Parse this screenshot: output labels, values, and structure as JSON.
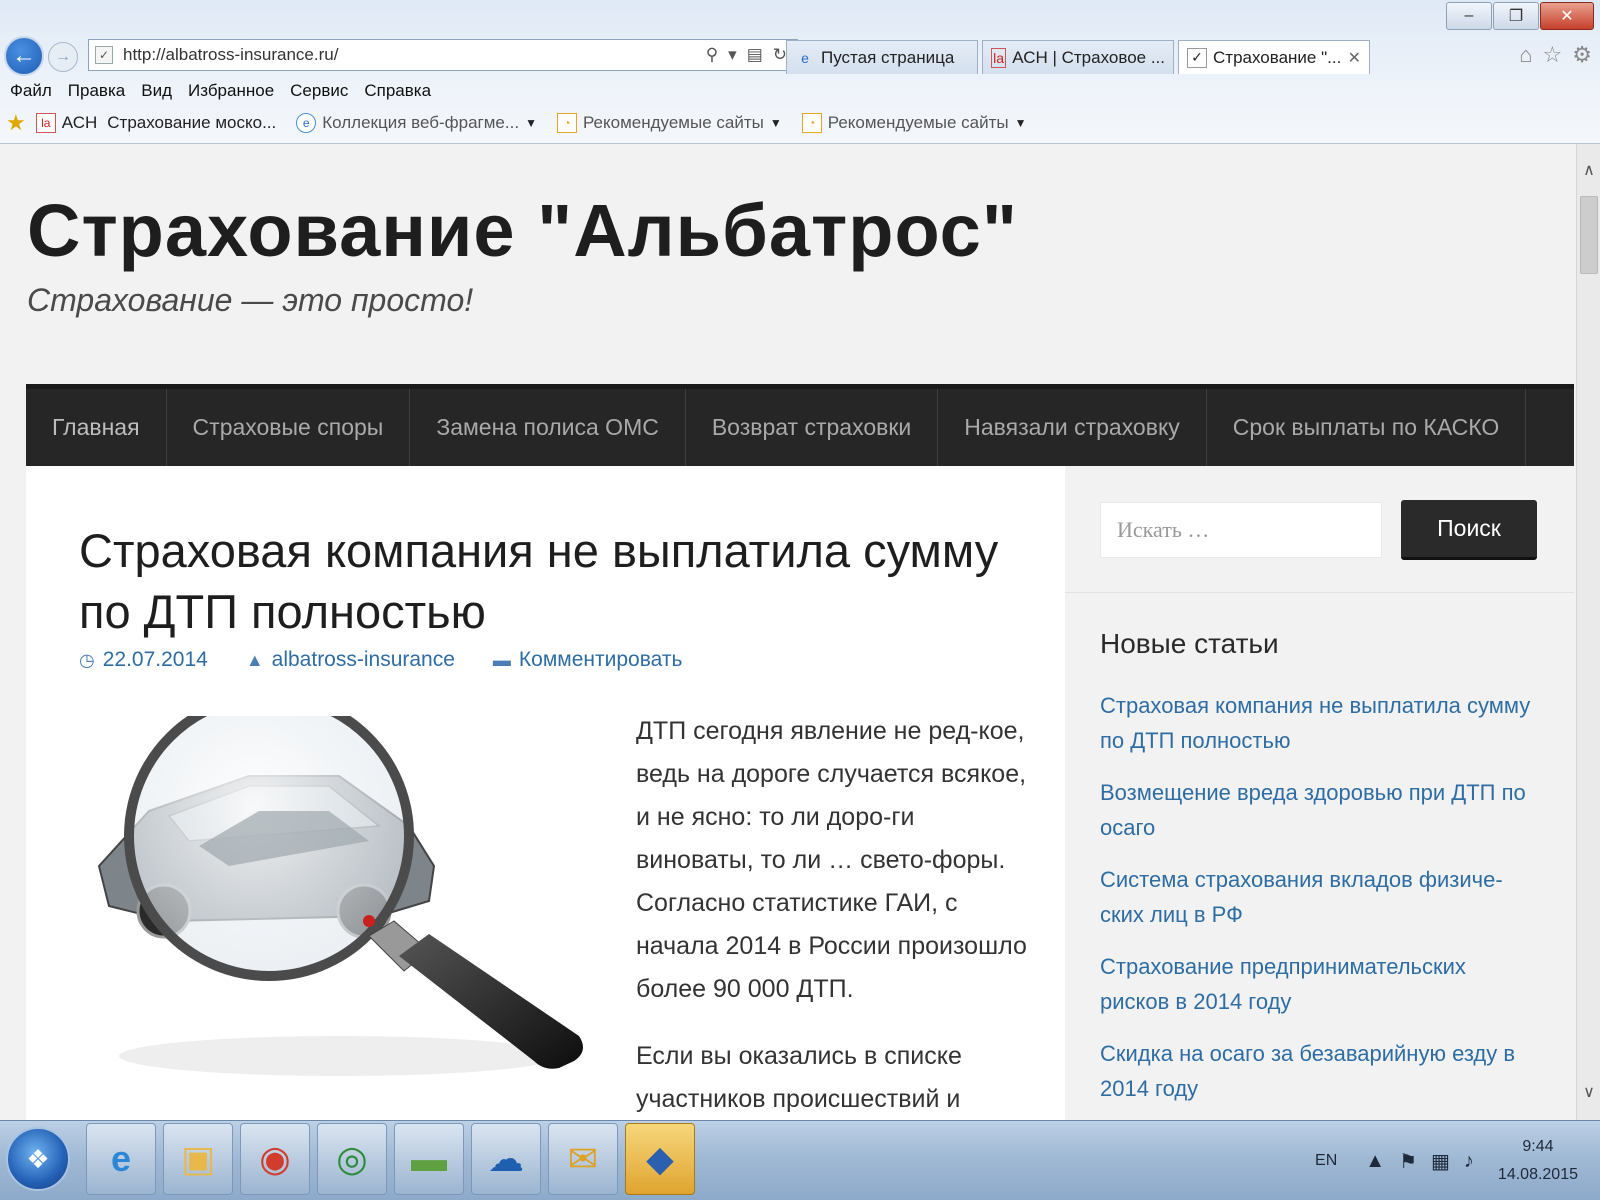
{
  "browser": {
    "url": "http://albatross-insurance.ru/",
    "tabs": [
      {
        "label": "Пустая страница",
        "icon": "ie-icon",
        "active": false
      },
      {
        "label": "АСН | Страховое ...",
        "icon": "asn-icon",
        "active": false
      },
      {
        "label": "Страхование \"...",
        "icon": "site-icon",
        "active": true
      }
    ],
    "menu": [
      "Файл",
      "Правка",
      "Вид",
      "Избранное",
      "Сервис",
      "Справка"
    ],
    "favorites": [
      {
        "label": "АСН",
        "icon": "asn-icon"
      },
      {
        "label": "Страхование моско...",
        "icon": ""
      },
      {
        "label": "Коллекция веб-фрагме...",
        "icon": "ie-icon"
      },
      {
        "label": "Рекомендуемые сайты",
        "icon": "rss-icon"
      },
      {
        "label": "Рекомендуемые сайты",
        "icon": "rss-icon"
      }
    ]
  },
  "site": {
    "title": "Страхование \"Альбатрос\"",
    "tagline": "Страхование — это просто!",
    "nav": [
      "Главная",
      "Страховые споры",
      "Замена полиса ОМС",
      "Возврат страховки",
      "Навязали страховку",
      "Срок выплаты по КАСКО"
    ]
  },
  "post": {
    "title": "Страховая компания не выплатила сумму по ДТП полностью",
    "date": "22.07.2014",
    "author": "albatross-insurance",
    "comment": "Комментировать",
    "paragraphs": [
      "ДТП сегодня явление не ред-кое, ведь на дороге случается всякое, и не ясно: то ли доро-ги виноваты, то ли … свето-форы. Согласно статистике ГАИ, с начала 2014 в России произошло более 90 000 ДТП.",
      "Если вы оказались в списке участников происшествий и"
    ]
  },
  "sidebar": {
    "search_placeholder": "Искать …",
    "search_button": "Поиск",
    "widget_title": "Новые статьи",
    "recent": [
      "Страховая компания не выплатила сумму по ДТП полностью",
      "Возмещение вреда здоровью при ДТП по осаго",
      "Система страхования вкладов физиче-ских лиц в РФ",
      "Страхование предпринимательских рисков в 2014 году",
      "Скидка на осаго за безаварийную езду в 2014 году"
    ]
  },
  "taskbar": {
    "lang": "EN",
    "time": "9:44",
    "date": "14.08.2015"
  },
  "colors": {
    "nav_bg": "#262626",
    "link": "#2e6da4",
    "text": "#333333"
  }
}
